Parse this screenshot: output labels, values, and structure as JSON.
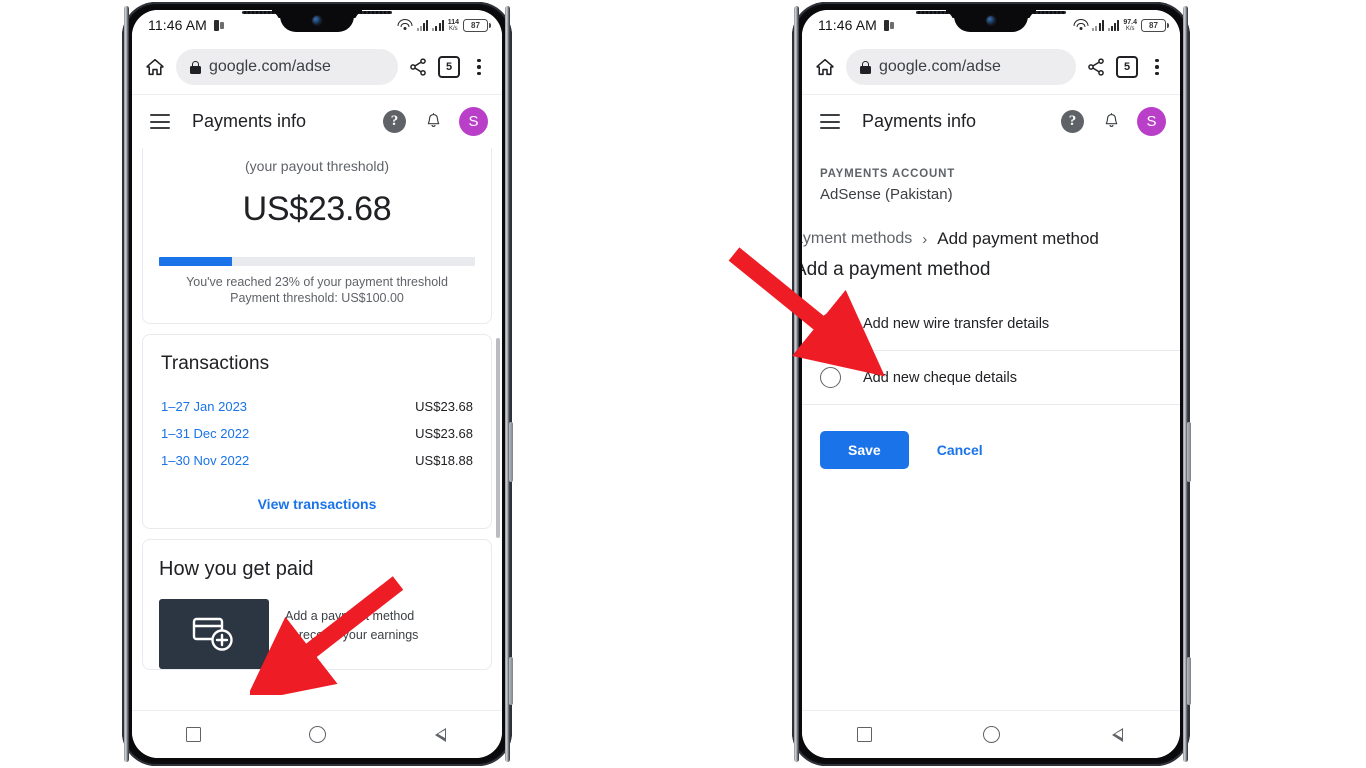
{
  "left_phone": {
    "status_bar": {
      "clock": "11:46 AM",
      "net_speed_value": "114",
      "net_speed_unit": "K/s",
      "battery": "87"
    },
    "browser": {
      "url": "google.com/adse",
      "tab_count": "5"
    },
    "app_header": {
      "title": "Payments info",
      "avatar_letter": "S"
    },
    "payout_card": {
      "threshold_note": "(your payout threshold)",
      "amount": "US$23.68",
      "progress_percent": 23,
      "progress_line_1": "You've reached 23% of your payment threshold",
      "progress_line_2": "Payment threshold: US$100.00"
    },
    "transactions_card": {
      "title": "Transactions",
      "rows": [
        {
          "date": "1–27 Jan 2023",
          "amount": "US$23.68"
        },
        {
          "date": "1–31 Dec 2022",
          "amount": "US$23.68"
        },
        {
          "date": "1–30 Nov 2022",
          "amount": "US$18.88"
        }
      ],
      "link": "View transactions"
    },
    "how_paid_card": {
      "title": "How you get paid",
      "text_line_1": "Add a payment method",
      "text_line_2": "to receive your earnings"
    }
  },
  "right_phone": {
    "status_bar": {
      "clock": "11:46 AM",
      "net_speed_value": "97.4",
      "net_speed_unit": "K/s",
      "battery": "87"
    },
    "browser": {
      "url": "google.com/adse",
      "tab_count": "5"
    },
    "app_header": {
      "title": "Payments info",
      "avatar_letter": "S"
    },
    "account": {
      "section_label": "PAYMENTS ACCOUNT",
      "account_name": "AdSense (Pakistan)"
    },
    "breadcrumb": {
      "previous": "ayment methods",
      "separator": "›",
      "current": "Add payment method"
    },
    "form": {
      "heading": "Add a payment method",
      "options": [
        {
          "label": "Add new wire transfer details",
          "selected": false
        },
        {
          "label": "Add new cheque details",
          "selected": false
        }
      ],
      "save_label": "Save",
      "cancel_label": "Cancel"
    }
  },
  "colors": {
    "google_blue": "#1a73e8",
    "avatar_purple": "#b93fc9",
    "arrow_red": "#ee1c25",
    "card_thumb_bg": "#2b3642"
  }
}
